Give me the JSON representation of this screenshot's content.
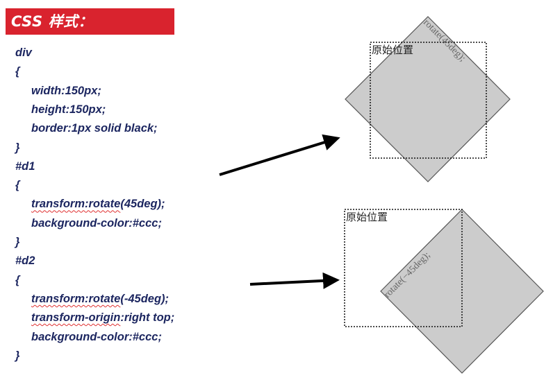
{
  "title": "CSS 样式：",
  "code_lines": [
    {
      "text": "div",
      "indent": false,
      "segments": null
    },
    {
      "text": "{",
      "indent": false,
      "segments": null
    },
    {
      "text": "width:150px;",
      "indent": true,
      "segments": null
    },
    {
      "text": "height:150px;",
      "indent": true,
      "segments": null
    },
    {
      "text": "border:1px solid black;",
      "indent": true,
      "segments": null
    },
    {
      "text": "}",
      "indent": false,
      "segments": null
    },
    {
      "text": "#d1",
      "indent": false,
      "segments": null
    },
    {
      "text": "{",
      "indent": false,
      "segments": null
    },
    {
      "text": "transform:rotate(45deg);",
      "indent": true,
      "segments": [
        {
          "text": "transform:rotate",
          "squiggle": true
        },
        {
          "text": "(45deg);",
          "squiggle": false
        }
      ]
    },
    {
      "text": "background-color:#ccc;",
      "indent": true,
      "segments": null
    },
    {
      "text": "}",
      "indent": false,
      "segments": null
    },
    {
      "text": "#d2",
      "indent": false,
      "segments": null
    },
    {
      "text": "{",
      "indent": false,
      "segments": null
    },
    {
      "text": "transform:rotate(-45deg);",
      "indent": true,
      "segments": [
        {
          "text": "transform:rotate",
          "squiggle": true
        },
        {
          "text": "(-45deg);",
          "squiggle": false
        }
      ]
    },
    {
      "text": "transform-origin:right top;",
      "indent": true,
      "segments": [
        {
          "text": "transform-origin",
          "squiggle": true
        },
        {
          "text": ":right top;",
          "squiggle": false
        }
      ]
    },
    {
      "text": "background-color:#ccc;",
      "indent": true,
      "segments": null
    },
    {
      "text": "}",
      "indent": false,
      "segments": null
    }
  ],
  "diagram1": {
    "original_label": "原始位置",
    "rotated_label": "rotate(45deg);"
  },
  "diagram2": {
    "original_label": "原始位置",
    "rotated_label": "rotate(−45deg);"
  },
  "colors": {
    "title_bg": "#d9232e",
    "code_text": "#1c2660",
    "rotated_fill": "#cccccc",
    "squiggle": "#e03030"
  }
}
